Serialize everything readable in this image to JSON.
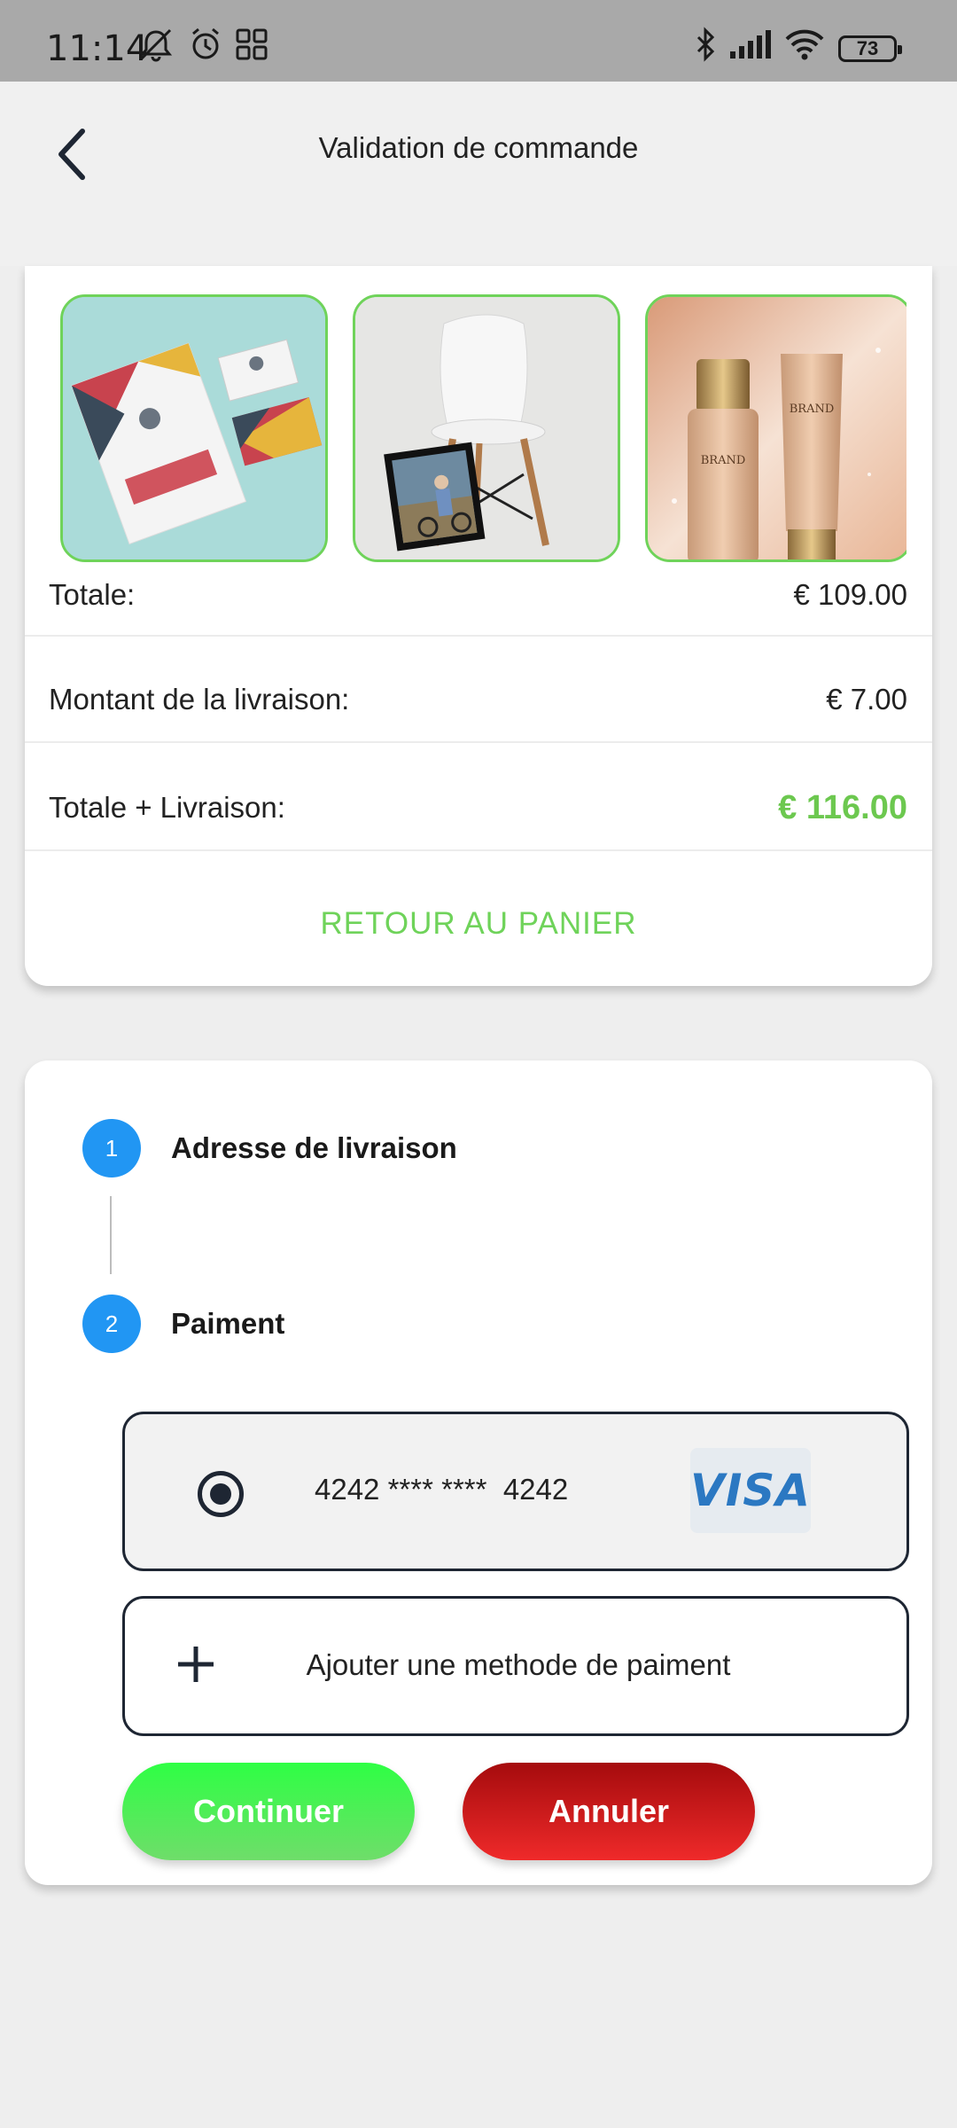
{
  "status_bar": {
    "time": "11:14",
    "battery": "73",
    "icons": [
      "mute-icon",
      "alarm-icon",
      "apps-icon",
      "bluetooth-icon",
      "signal-icon",
      "wifi-icon",
      "battery-icon"
    ]
  },
  "header": {
    "title": "Validation de commande",
    "back_icon": "chevron-left-icon"
  },
  "cart": {
    "products": [
      {
        "name": "brochure-and-business-cards",
        "icon": "product-image"
      },
      {
        "name": "chair-with-photo-frame",
        "icon": "product-image"
      },
      {
        "name": "cosmetic-bottles",
        "icon": "product-image",
        "brand_text": "BRAND"
      }
    ],
    "rows": [
      {
        "label": "Totale:",
        "value": "€ 109.00"
      },
      {
        "label": "Montant de la livraison:",
        "value": "€ 7.00"
      },
      {
        "label": "Totale + Livraison:",
        "value": "€ 116.00"
      }
    ],
    "back_to_cart": "RETOUR AU PANIER"
  },
  "steps": [
    {
      "number": "1",
      "label": "Adresse de livraison"
    },
    {
      "number": "2",
      "label": "Paiment"
    }
  ],
  "payment": {
    "card_number": "4242 **** ****  4242",
    "card_brand": "VISA",
    "add_method": "Ajouter une methode de paiment"
  },
  "actions": {
    "continue": "Continuer",
    "cancel": "Annuler"
  },
  "colors": {
    "accent_green": "#6fd35a",
    "step_blue": "#2196f3",
    "cancel_red": "#d01818",
    "visa_blue": "#2b78c2"
  }
}
